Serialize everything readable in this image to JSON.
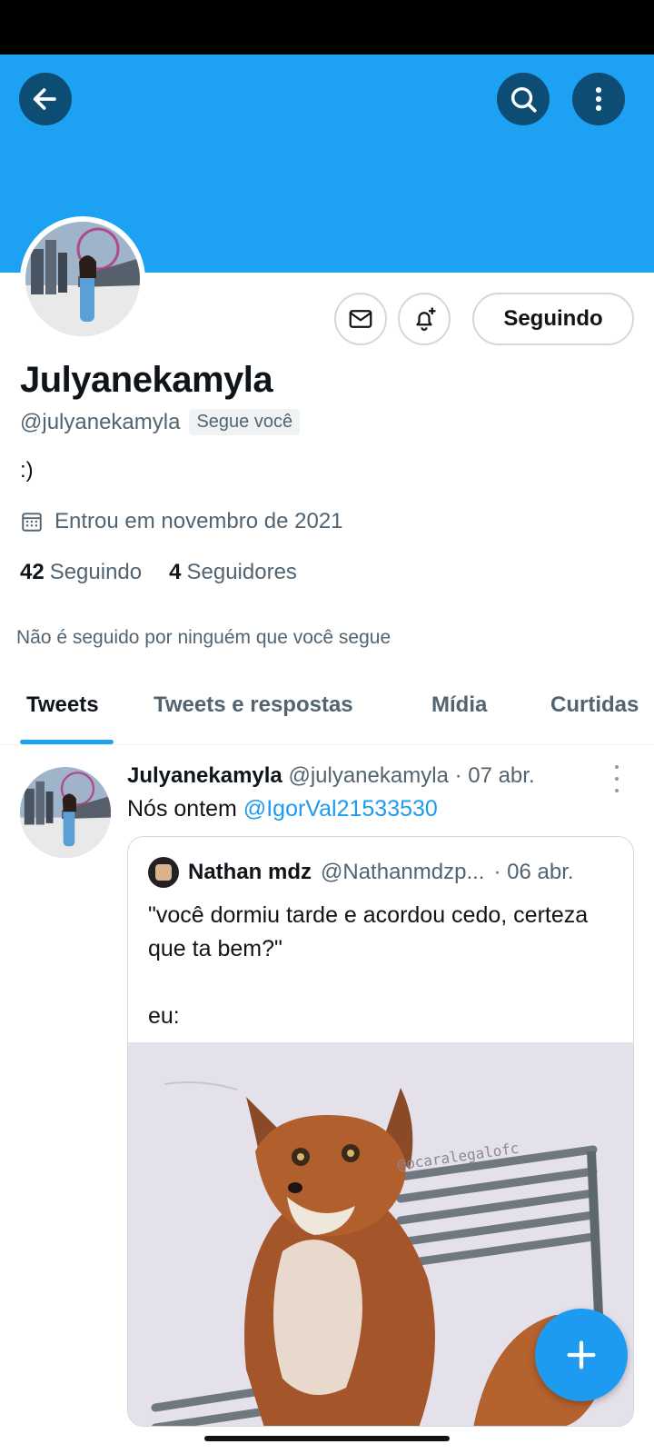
{
  "header": {
    "back_icon": "arrow-left-icon",
    "search_icon": "search-icon",
    "more_icon": "vertical-ellipsis-icon",
    "banner_color": "#1da1f2"
  },
  "profile": {
    "display_name": "Julyanekamyla",
    "handle": "@julyanekamyla",
    "follows_you_badge": "Segue você",
    "bio": ":)",
    "joined": "Entrou em novembro de 2021",
    "following_count": "42",
    "following_label": "Seguindo",
    "followers_count": "4",
    "followers_label": "Seguidores",
    "mutual_info": "Não é seguido por ninguém que você segue",
    "actions": {
      "message_icon": "envelope-icon",
      "notify_icon": "bell-plus-icon",
      "follow_button_label": "Seguindo"
    }
  },
  "tabs": [
    {
      "label": "Tweets",
      "active": true
    },
    {
      "label": "Tweets e respostas",
      "active": false
    },
    {
      "label": "Mídia",
      "active": false
    },
    {
      "label": "Curtidas",
      "active": false
    }
  ],
  "tweet": {
    "author_name": "Julyanekamyla",
    "author_handle": "@julyanekamyla",
    "date": "· 07 abr.",
    "text": "Nós ontem ",
    "mention": "@IgorVal21533530",
    "quote": {
      "author_name": "Nathan mdz",
      "author_handle": "@Nathanmdzp...",
      "date": "· 06 abr.",
      "text": "\"você dormiu tarde e acordou cedo, certeza que ta bem?\"\n\neu:",
      "image_watermark": "@ocaralegalofc"
    }
  },
  "fab": {
    "icon": "plus-icon",
    "color": "#1d9bf0"
  }
}
